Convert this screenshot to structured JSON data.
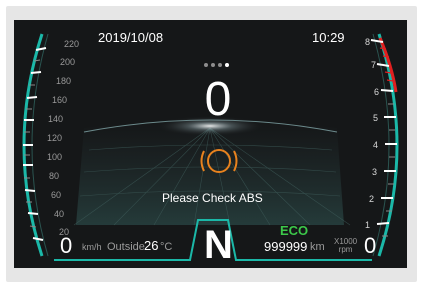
{
  "header": {
    "date": "2019/10/08",
    "time": "10:29"
  },
  "pager": {
    "count": 4,
    "active_index": 3
  },
  "speedometer": {
    "value": "0",
    "current_display": "0",
    "unit": "km/h",
    "ticks": [
      "220",
      "200",
      "180",
      "160",
      "140",
      "120",
      "100",
      "80",
      "60",
      "40",
      "20"
    ]
  },
  "tachometer": {
    "current_display": "0",
    "unit_line1": "X1000",
    "unit_line2": "rpm",
    "ticks": [
      "8",
      "7",
      "6",
      "5",
      "4",
      "3",
      "2",
      "1"
    ],
    "redline_color": "#e02020"
  },
  "warning": {
    "icon": "abs-warning-icon",
    "icon_text": "ABS",
    "message": "Please Check ABS",
    "color": "#e8821e"
  },
  "drive": {
    "gear": "N",
    "mode": "ECO",
    "mode_color": "#3cc84a"
  },
  "odometer": {
    "value": "999999",
    "unit": "km"
  },
  "outside_temp": {
    "label": "Outside",
    "value": "26",
    "unit": "°C"
  },
  "colors": {
    "gauge_accent": "#1bb8a8",
    "background": "#151718"
  }
}
